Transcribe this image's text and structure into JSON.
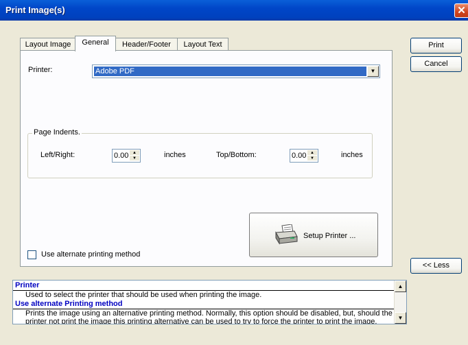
{
  "window": {
    "title": "Print Image(s)",
    "close_glyph": "✕"
  },
  "tabs": [
    {
      "label": "Layout Image"
    },
    {
      "label": "General"
    },
    {
      "label": "Header/Footer"
    },
    {
      "label": "Layout Text"
    }
  ],
  "general": {
    "printer_label": "Printer:",
    "printer_value": "Adobe PDF",
    "page_indents": {
      "legend": "Page Indents.",
      "left_right_label": "Left/Right:",
      "left_right_value": "0.00",
      "left_right_unit": "inches",
      "top_bottom_label": "Top/Bottom:",
      "top_bottom_value": "0.00",
      "top_bottom_unit": "inches"
    },
    "setup_printer_label": "Setup Printer ...",
    "alt_method_label": "Use alternate printing method",
    "alt_method_checked": false
  },
  "buttons": {
    "print": "Print",
    "cancel": "Cancel",
    "less": "<< Less"
  },
  "help": [
    {
      "title": "Printer",
      "text": "Used to select the printer that should be used when printing the image."
    },
    {
      "title": "Use alternate Printing method",
      "text": "Prints the image using an alternative printing method.  Normally, this option should be disabled, but, should the printer not print the image this printing alternative can be used to try to force the printer to print the image."
    }
  ]
}
